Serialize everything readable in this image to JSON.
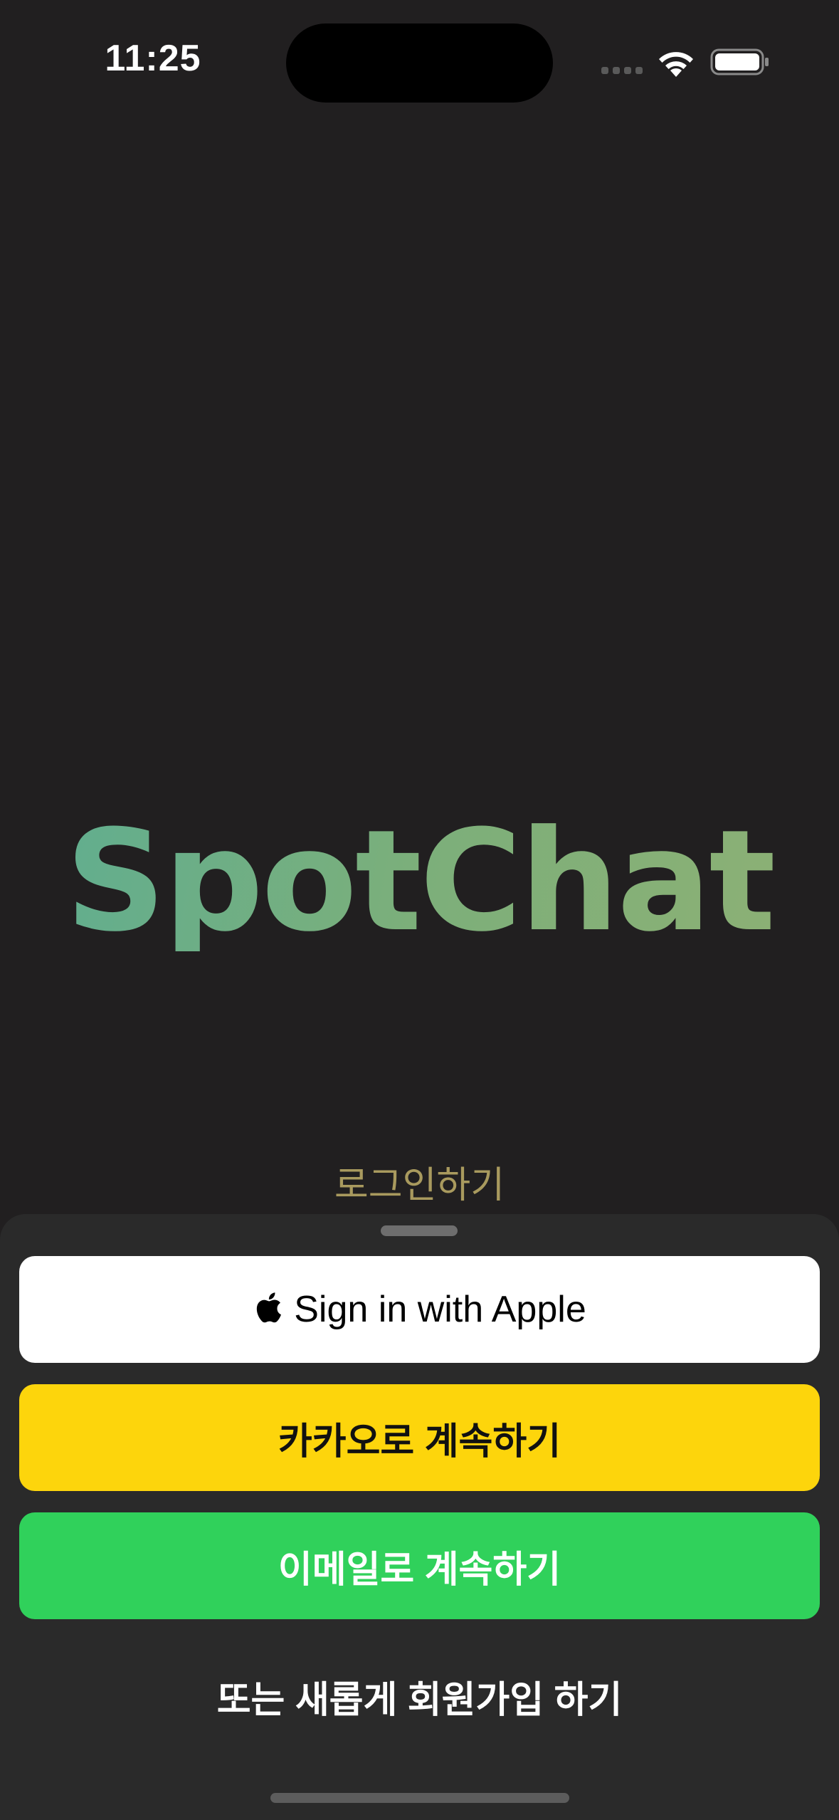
{
  "status_bar": {
    "time": "11:25",
    "icons": [
      "cellular-signal-icon",
      "wifi-icon",
      "battery-icon"
    ]
  },
  "app": {
    "logo_text": "SpotChat",
    "logo_gradient": [
      "#5dae92",
      "#8eb074"
    ]
  },
  "login": {
    "title": "로그인하기",
    "apple_button_label": "Sign in with Apple",
    "kakao_button_label": "카카오로 계속하기",
    "email_button_label": "이메일로 계속하기",
    "signup_link_label": "또는 새롭게 회원가입 하기"
  },
  "colors": {
    "background": "#211f20",
    "sheet": "#2a2a2a",
    "kakao": "#fdd50c",
    "email": "#30d15b",
    "apple": "#ffffff",
    "title_accent": "#a99a5e"
  }
}
